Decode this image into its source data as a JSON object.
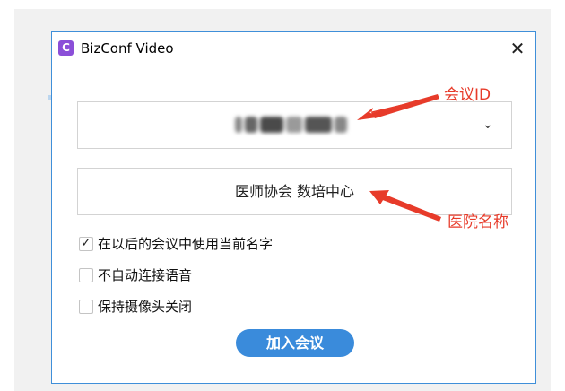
{
  "window": {
    "title": "BizConf Video",
    "app_icon_letter": "C",
    "close_label": "✕"
  },
  "meeting_id": {
    "value_obscured": true,
    "chevron": "⌄"
  },
  "name_field": {
    "value": "医师协会 数培中心"
  },
  "checkboxes": [
    {
      "label": "在以后的会议中使用当前名字",
      "checked": true
    },
    {
      "label": "不自动连接语音",
      "checked": false
    },
    {
      "label": "保持摄像头关闭",
      "checked": false
    }
  ],
  "join_button": {
    "label": "加入会议"
  },
  "annotations": [
    {
      "label": "会议ID"
    },
    {
      "label": "医院名称"
    }
  ],
  "colors": {
    "accent_blue": "#3a8bdb",
    "window_border": "#3f8fd9",
    "annotation_red": "#e73b2a",
    "app_icon": "#8b4fd8"
  }
}
